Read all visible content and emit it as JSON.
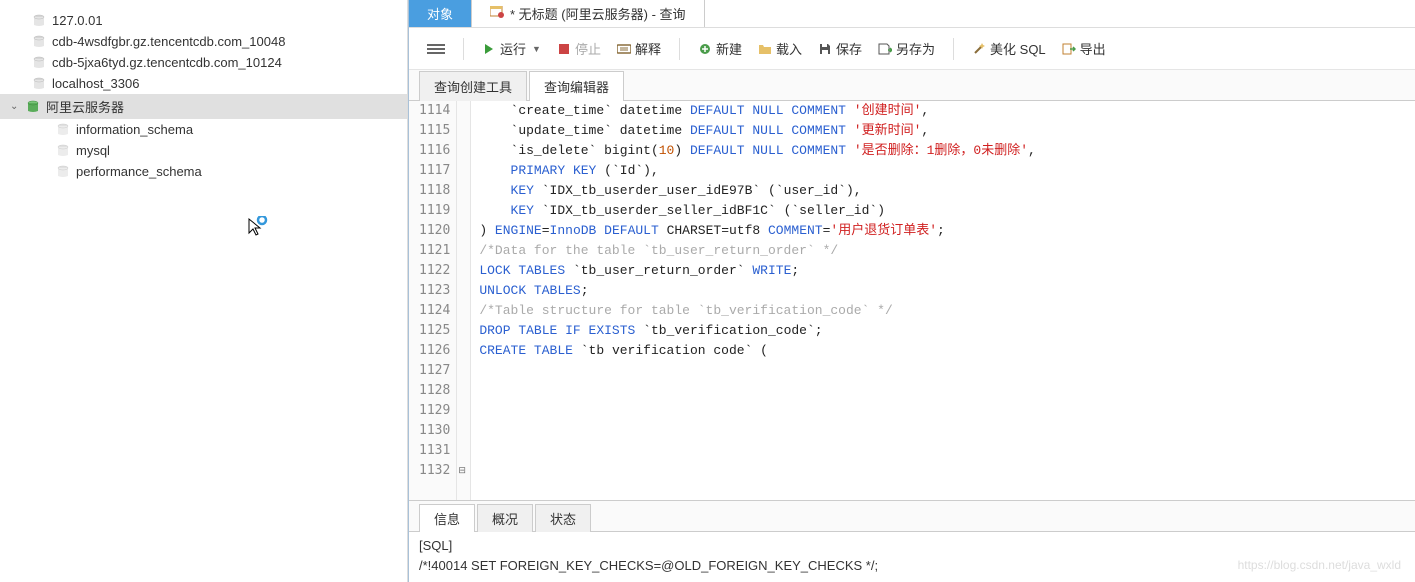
{
  "sidebar": {
    "items": [
      {
        "label": "127.0.01",
        "state": "off",
        "level": 1
      },
      {
        "label": "cdb-4wsdfgbr.gz.tencentcdb.com_10048",
        "state": "off",
        "level": 1
      },
      {
        "label": "cdb-5jxa6tyd.gz.tencentcdb.com_10124",
        "state": "off",
        "level": 1
      },
      {
        "label": "localhost_3306",
        "state": "off",
        "level": 1
      },
      {
        "label": "阿里云服务器",
        "state": "on",
        "level": 2,
        "selected": true,
        "expanded": true
      },
      {
        "label": "information_schema",
        "state": "schema",
        "level": 3
      },
      {
        "label": "mysql",
        "state": "schema",
        "level": 3
      },
      {
        "label": "performance_schema",
        "state": "schema",
        "level": 3
      }
    ]
  },
  "topTabs": [
    {
      "label": "对象",
      "active": true
    },
    {
      "label": "* 无标题 (阿里云服务器) - 查询",
      "active": false,
      "icon": "query"
    }
  ],
  "toolbar": {
    "run": "运行",
    "stop": "停止",
    "explain": "解释",
    "new": "新建",
    "load": "载入",
    "save": "保存",
    "saveas": "另存为",
    "beautify": "美化 SQL",
    "export": "导出"
  },
  "queryTabs": [
    {
      "label": "查询创建工具",
      "active": false
    },
    {
      "label": "查询编辑器",
      "active": true
    }
  ],
  "editor": {
    "startLine": 1114,
    "lines": [
      {
        "parts": [
          [
            "    `create_time` datetime ",
            ""
          ],
          [
            "DEFAULT NULL COMMENT",
            "bk"
          ],
          [
            " ",
            ""
          ],
          [
            "'创建时间'",
            "red"
          ],
          [
            ",",
            ""
          ]
        ]
      },
      {
        "parts": [
          [
            "    `update_time` datetime ",
            ""
          ],
          [
            "DEFAULT NULL COMMENT",
            "bk"
          ],
          [
            " ",
            ""
          ],
          [
            "'更新时间'",
            "red"
          ],
          [
            ",",
            ""
          ]
        ]
      },
      {
        "parts": [
          [
            "    `is_delete` bigint(",
            ""
          ],
          [
            "10",
            "num"
          ],
          [
            ") ",
            ""
          ],
          [
            "DEFAULT NULL COMMENT",
            "bk"
          ],
          [
            " ",
            ""
          ],
          [
            "'是否删除：1删除，0未删除'",
            "red"
          ],
          [
            ",",
            ""
          ]
        ]
      },
      {
        "parts": [
          [
            "    ",
            ""
          ],
          [
            "PRIMARY KEY",
            "bk"
          ],
          [
            " (`Id`),",
            ""
          ]
        ]
      },
      {
        "parts": [
          [
            "    ",
            ""
          ],
          [
            "KEY",
            "bk"
          ],
          [
            " `IDX_tb_userder_user_idE97B` (`user_id`),",
            ""
          ]
        ]
      },
      {
        "parts": [
          [
            "    ",
            ""
          ],
          [
            "KEY",
            "bk"
          ],
          [
            " `IDX_tb_userder_seller_idBF1C` (`seller_id`)",
            ""
          ]
        ]
      },
      {
        "parts": [
          [
            ") ",
            ""
          ],
          [
            "ENGINE",
            "bk"
          ],
          [
            "=",
            ""
          ],
          [
            "InnoDB",
            "bk"
          ],
          [
            " ",
            ""
          ],
          [
            "DEFAULT",
            "bk"
          ],
          [
            " CHARSET=utf8 ",
            ""
          ],
          [
            "COMMENT",
            "bk"
          ],
          [
            "=",
            ""
          ],
          [
            "'用户退货订单表'",
            "red"
          ],
          [
            ";",
            ""
          ]
        ]
      },
      {
        "parts": [
          [
            "",
            ""
          ]
        ]
      },
      {
        "parts": [
          [
            "/*Data for the table `tb_user_return_order` */",
            "gray"
          ]
        ]
      },
      {
        "parts": [
          [
            "",
            ""
          ]
        ]
      },
      {
        "parts": [
          [
            "LOCK TABLES",
            "bk"
          ],
          [
            " `tb_user_return_order` ",
            ""
          ],
          [
            "WRITE",
            "bk"
          ],
          [
            ";",
            ""
          ]
        ]
      },
      {
        "parts": [
          [
            "",
            ""
          ]
        ]
      },
      {
        "parts": [
          [
            "UNLOCK TABLES",
            "bk"
          ],
          [
            ";",
            ""
          ]
        ]
      },
      {
        "parts": [
          [
            "",
            ""
          ]
        ]
      },
      {
        "parts": [
          [
            "/*Table structure for table `tb_verification_code` */",
            "gray"
          ]
        ]
      },
      {
        "parts": [
          [
            "",
            ""
          ]
        ]
      },
      {
        "parts": [
          [
            "DROP TABLE IF EXISTS",
            "bk"
          ],
          [
            " `tb_verification_code`;",
            ""
          ]
        ]
      },
      {
        "parts": [
          [
            "",
            ""
          ]
        ]
      },
      {
        "parts": [
          [
            "CREATE TABLE",
            "bk"
          ],
          [
            " `tb verification code` (",
            ""
          ]
        ],
        "fold": true
      }
    ]
  },
  "statusTabs": [
    {
      "label": "信息",
      "active": true
    },
    {
      "label": "概况",
      "active": false
    },
    {
      "label": "状态",
      "active": false
    }
  ],
  "output": {
    "line1": "[SQL]",
    "line2": "/*!40014 SET FOREIGN_KEY_CHECKS=@OLD_FOREIGN_KEY_CHECKS */;"
  },
  "watermark": "https://blog.csdn.net/java_wxld"
}
